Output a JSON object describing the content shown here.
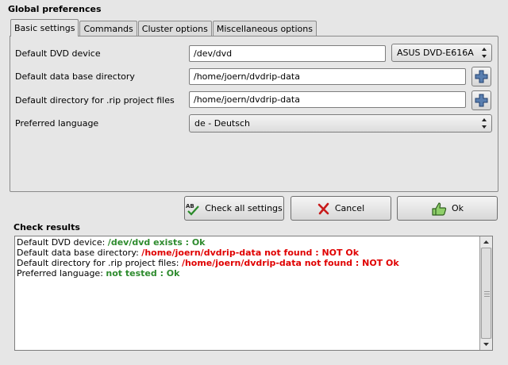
{
  "window": {
    "title": "Global preferences"
  },
  "tabs": [
    {
      "label": "Basic settings",
      "active": true
    },
    {
      "label": "Commands",
      "active": false
    },
    {
      "label": "Cluster options",
      "active": false
    },
    {
      "label": "Miscellaneous options",
      "active": false
    }
  ],
  "settings": {
    "dvd_device": {
      "label": "Default DVD device",
      "value": "/dev/dvd",
      "device_selected": "ASUS DVD-E616A"
    },
    "data_dir": {
      "label": "Default data base directory",
      "value": "/home/joern/dvdrip-data"
    },
    "rip_dir": {
      "label": "Default directory for .rip project files",
      "value": "/home/joern/dvdrip-data"
    },
    "language": {
      "label": "Preferred language",
      "selected": "de - Deutsch"
    }
  },
  "buttons": {
    "check_all": "Check all settings",
    "cancel": "Cancel",
    "ok": "Ok"
  },
  "check_results": {
    "title": "Check results",
    "lines": [
      {
        "prefix": "Default DVD device: ",
        "status": "/dev/dvd exists : Ok",
        "ok": true
      },
      {
        "prefix": "Default data base directory: ",
        "status": "/home/joern/dvdrip-data not found : NOT Ok",
        "ok": false
      },
      {
        "prefix": "Default directory for .rip project files: ",
        "status": "/home/joern/dvdrip-data not found : NOT Ok",
        "ok": false
      },
      {
        "prefix": "Preferred language: ",
        "status": "not tested : Ok",
        "ok": true
      }
    ]
  },
  "colors": {
    "ok": "#2e8b2e",
    "not_ok": "#e00000",
    "background": "#e6e6e6"
  },
  "icons": {
    "check_all": "spellcheck-icon",
    "cancel": "cancel-x-icon",
    "ok": "thumbs-up-icon",
    "browse": "plus-icon",
    "combo": "combo-arrows-icon"
  }
}
